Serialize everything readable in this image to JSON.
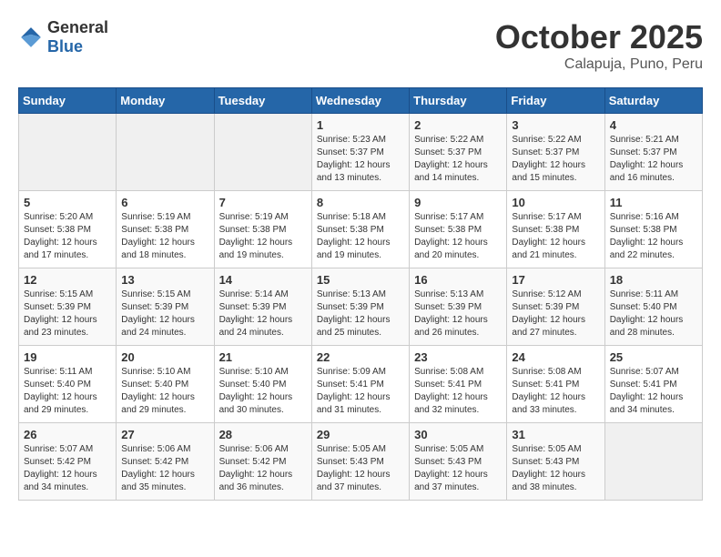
{
  "header": {
    "logo_general": "General",
    "logo_blue": "Blue",
    "month": "October 2025",
    "location": "Calapuja, Puno, Peru"
  },
  "days_of_week": [
    "Sunday",
    "Monday",
    "Tuesday",
    "Wednesday",
    "Thursday",
    "Friday",
    "Saturday"
  ],
  "weeks": [
    [
      {
        "day": "",
        "info": ""
      },
      {
        "day": "",
        "info": ""
      },
      {
        "day": "",
        "info": ""
      },
      {
        "day": "1",
        "info": "Sunrise: 5:23 AM\nSunset: 5:37 PM\nDaylight: 12 hours\nand 13 minutes."
      },
      {
        "day": "2",
        "info": "Sunrise: 5:22 AM\nSunset: 5:37 PM\nDaylight: 12 hours\nand 14 minutes."
      },
      {
        "day": "3",
        "info": "Sunrise: 5:22 AM\nSunset: 5:37 PM\nDaylight: 12 hours\nand 15 minutes."
      },
      {
        "day": "4",
        "info": "Sunrise: 5:21 AM\nSunset: 5:37 PM\nDaylight: 12 hours\nand 16 minutes."
      }
    ],
    [
      {
        "day": "5",
        "info": "Sunrise: 5:20 AM\nSunset: 5:38 PM\nDaylight: 12 hours\nand 17 minutes."
      },
      {
        "day": "6",
        "info": "Sunrise: 5:19 AM\nSunset: 5:38 PM\nDaylight: 12 hours\nand 18 minutes."
      },
      {
        "day": "7",
        "info": "Sunrise: 5:19 AM\nSunset: 5:38 PM\nDaylight: 12 hours\nand 19 minutes."
      },
      {
        "day": "8",
        "info": "Sunrise: 5:18 AM\nSunset: 5:38 PM\nDaylight: 12 hours\nand 19 minutes."
      },
      {
        "day": "9",
        "info": "Sunrise: 5:17 AM\nSunset: 5:38 PM\nDaylight: 12 hours\nand 20 minutes."
      },
      {
        "day": "10",
        "info": "Sunrise: 5:17 AM\nSunset: 5:38 PM\nDaylight: 12 hours\nand 21 minutes."
      },
      {
        "day": "11",
        "info": "Sunrise: 5:16 AM\nSunset: 5:38 PM\nDaylight: 12 hours\nand 22 minutes."
      }
    ],
    [
      {
        "day": "12",
        "info": "Sunrise: 5:15 AM\nSunset: 5:39 PM\nDaylight: 12 hours\nand 23 minutes."
      },
      {
        "day": "13",
        "info": "Sunrise: 5:15 AM\nSunset: 5:39 PM\nDaylight: 12 hours\nand 24 minutes."
      },
      {
        "day": "14",
        "info": "Sunrise: 5:14 AM\nSunset: 5:39 PM\nDaylight: 12 hours\nand 24 minutes."
      },
      {
        "day": "15",
        "info": "Sunrise: 5:13 AM\nSunset: 5:39 PM\nDaylight: 12 hours\nand 25 minutes."
      },
      {
        "day": "16",
        "info": "Sunrise: 5:13 AM\nSunset: 5:39 PM\nDaylight: 12 hours\nand 26 minutes."
      },
      {
        "day": "17",
        "info": "Sunrise: 5:12 AM\nSunset: 5:39 PM\nDaylight: 12 hours\nand 27 minutes."
      },
      {
        "day": "18",
        "info": "Sunrise: 5:11 AM\nSunset: 5:40 PM\nDaylight: 12 hours\nand 28 minutes."
      }
    ],
    [
      {
        "day": "19",
        "info": "Sunrise: 5:11 AM\nSunset: 5:40 PM\nDaylight: 12 hours\nand 29 minutes."
      },
      {
        "day": "20",
        "info": "Sunrise: 5:10 AM\nSunset: 5:40 PM\nDaylight: 12 hours\nand 29 minutes."
      },
      {
        "day": "21",
        "info": "Sunrise: 5:10 AM\nSunset: 5:40 PM\nDaylight: 12 hours\nand 30 minutes."
      },
      {
        "day": "22",
        "info": "Sunrise: 5:09 AM\nSunset: 5:41 PM\nDaylight: 12 hours\nand 31 minutes."
      },
      {
        "day": "23",
        "info": "Sunrise: 5:08 AM\nSunset: 5:41 PM\nDaylight: 12 hours\nand 32 minutes."
      },
      {
        "day": "24",
        "info": "Sunrise: 5:08 AM\nSunset: 5:41 PM\nDaylight: 12 hours\nand 33 minutes."
      },
      {
        "day": "25",
        "info": "Sunrise: 5:07 AM\nSunset: 5:41 PM\nDaylight: 12 hours\nand 34 minutes."
      }
    ],
    [
      {
        "day": "26",
        "info": "Sunrise: 5:07 AM\nSunset: 5:42 PM\nDaylight: 12 hours\nand 34 minutes."
      },
      {
        "day": "27",
        "info": "Sunrise: 5:06 AM\nSunset: 5:42 PM\nDaylight: 12 hours\nand 35 minutes."
      },
      {
        "day": "28",
        "info": "Sunrise: 5:06 AM\nSunset: 5:42 PM\nDaylight: 12 hours\nand 36 minutes."
      },
      {
        "day": "29",
        "info": "Sunrise: 5:05 AM\nSunset: 5:43 PM\nDaylight: 12 hours\nand 37 minutes."
      },
      {
        "day": "30",
        "info": "Sunrise: 5:05 AM\nSunset: 5:43 PM\nDaylight: 12 hours\nand 37 minutes."
      },
      {
        "day": "31",
        "info": "Sunrise: 5:05 AM\nSunset: 5:43 PM\nDaylight: 12 hours\nand 38 minutes."
      },
      {
        "day": "",
        "info": ""
      }
    ]
  ]
}
